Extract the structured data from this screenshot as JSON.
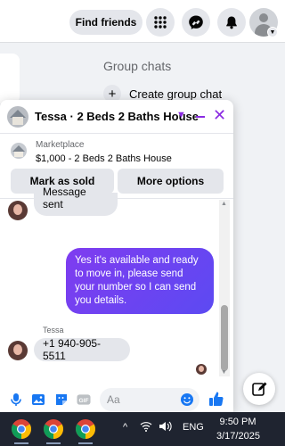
{
  "topbar": {
    "find_friends": "Find friends",
    "icons": [
      "menu-grid-icon",
      "messenger-icon",
      "bell-icon",
      "profile-avatar"
    ]
  },
  "page": {
    "group_chats": "Group chats",
    "create_group": "Create group chat"
  },
  "chat": {
    "title": "Tessa · 2 Beds 2 Baths House",
    "marketplace_label": "Marketplace",
    "listing": "$1,000 - 2 Beds 2 Baths House",
    "buttons": {
      "mark_sold": "Mark as sold",
      "more_options": "More options"
    },
    "messages": {
      "partial_incoming": "Message sent",
      "outgoing": "Yes it's available and ready to move in, please send your number so I can send you details.",
      "sender_name": "Tessa",
      "incoming_phone": "+1 940-905-5511"
    },
    "composer_placeholder": "Aa"
  },
  "taskbar": {
    "language": "ENG",
    "time": "9:50 PM",
    "date": "3/17/2025"
  },
  "colors": {
    "accent": "#8a2be2",
    "bubble_start": "#7f3cf0",
    "bubble_end": "#5c4af2",
    "like_blue": "#1877f2"
  }
}
